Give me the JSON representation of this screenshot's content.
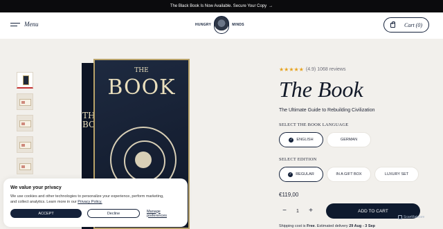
{
  "announcement": {
    "text": "The Black Book Is Now Available. Secure Your Copy",
    "arrow": "→"
  },
  "header": {
    "menu_label": "Menu",
    "logo_left": "HUNGRY",
    "logo_right": "MINDS",
    "cart_label": "Cart (0)"
  },
  "gallery": {
    "thumbnails": [
      "book-cover",
      "book-spread",
      "book-page",
      "book-page",
      "book-page"
    ],
    "active_index": 0
  },
  "book_image": {
    "the": "THE",
    "title": "BOOK",
    "spine": "THE BOOK"
  },
  "product": {
    "stars": "★★★★★",
    "rating_text": "(4.9) 1068 reviews",
    "title": "The Book",
    "subtitle": "The Ultimate Guide to Rebuilding Civilization",
    "language_label": "SELECT THE BOOK LANGUAGE",
    "languages": [
      "ENGLISH",
      "GERMAN"
    ],
    "selected_language": "ENGLISH",
    "edition_label": "SELECT EDITION",
    "editions": [
      "REGULAR",
      "IN A GIFT BOX",
      "LUXURY SET"
    ],
    "selected_edition": "REGULAR",
    "price": "€119,00",
    "quantity": "1",
    "minus": "−",
    "plus": "+",
    "add_to_cart": "ADD TO CART",
    "shipping_prefix": "Shipping cost is",
    "shipping_free": "Free",
    "shipping_middle": ". Estimated delivery",
    "shipping_dates": "29 Aug - 3 Sep"
  },
  "cookie": {
    "title": "We value your privacy",
    "text": "We use cookies and other technologies to personalize your experience, perform marketing, and collect analytics. Learn more in our",
    "policy_link": "Privacy Policy.",
    "accept": "ACCEPT",
    "decline": "Decline",
    "manage": "Manage preferences"
  },
  "watermark": {
    "text": "ScanMalware"
  },
  "colors": {
    "navy": "#14213a",
    "star": "#e6a21e",
    "background": "#f2f0ec"
  }
}
